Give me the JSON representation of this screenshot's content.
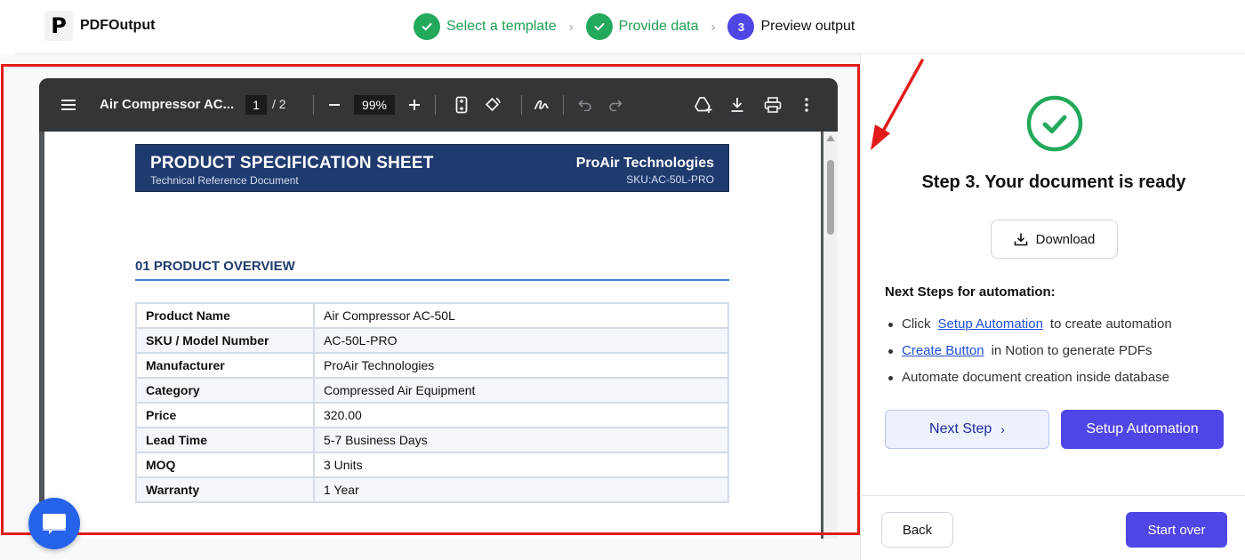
{
  "app": {
    "logo_letter": "P",
    "name": "PDFOutput"
  },
  "stepper": {
    "steps": [
      {
        "label": "Select a template",
        "state": "done"
      },
      {
        "label": "Provide data",
        "state": "done"
      },
      {
        "label": "Preview output",
        "state": "active",
        "number": "3"
      }
    ]
  },
  "viewer": {
    "doc_title": "Air Compressor AC...",
    "current_page": "1",
    "total_pages": "/  2",
    "zoom": "99%",
    "icons": [
      "menu-icon",
      "zoom-out-icon",
      "zoom-in-icon",
      "fit-page-icon",
      "rotate-icon",
      "draw-icon",
      "undo-icon",
      "redo-icon",
      "drive-add-icon",
      "download-icon",
      "print-icon",
      "more-icon"
    ]
  },
  "document": {
    "header_title": "PRODUCT SPECIFICATION SHEET",
    "header_subtitle": "Technical Reference Document",
    "company": "ProAir Technologies",
    "sku": "SKU:AC-50L-PRO",
    "section_title": "01  PRODUCT OVERVIEW",
    "rows": [
      {
        "key": "Product Name",
        "value": "Air Compressor AC-50L"
      },
      {
        "key": "SKU / Model Number",
        "value": "AC-50L-PRO"
      },
      {
        "key": "Manufacturer",
        "value": "ProAir Technologies"
      },
      {
        "key": "Category",
        "value": "Compressed Air Equipment"
      },
      {
        "key": "Price",
        "value": "320.00"
      },
      {
        "key": "Lead Time",
        "value": "5-7 Business Days"
      },
      {
        "key": "MOQ",
        "value": "3 Units"
      },
      {
        "key": "Warranty",
        "value": "1 Year"
      }
    ]
  },
  "result": {
    "title": "Step 3. Your document is ready",
    "download_label": "Download",
    "next_steps_title": "Next Steps for automation:",
    "step1_prefix": "Click",
    "step1_link": "Setup Automation",
    "step1_suffix": "to create automation",
    "step2_link": "Create Button",
    "step2_suffix": "in Notion to generate PDFs",
    "step3_text": "Automate document creation inside database",
    "next_step_label": "Next Step",
    "setup_automation_label": "Setup Automation",
    "back_label": "Back",
    "start_over_label": "Start over"
  },
  "colors": {
    "accent": "#4f46e5",
    "success": "#22a95c",
    "highlight_frame": "#e31b1b",
    "doc_header": "#1f3a6e"
  }
}
